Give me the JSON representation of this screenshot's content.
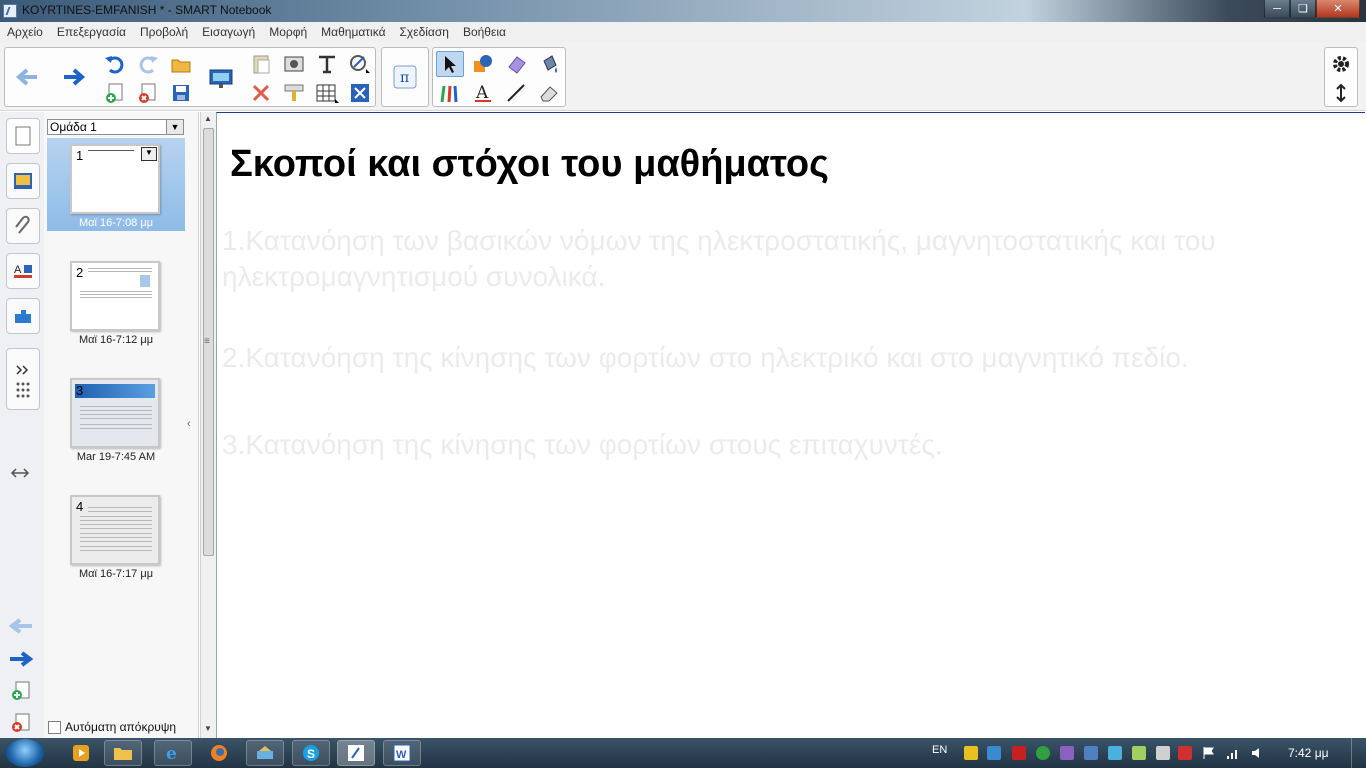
{
  "window": {
    "title": "KOYRTINES-EMFANISH * - SMART Notebook",
    "controls": [
      "minimize",
      "maximize",
      "close"
    ]
  },
  "menu": [
    "Αρχείο",
    "Επεξεργασία",
    "Προβολή",
    "Εισαγωγή",
    "Μορφή",
    "Μαθηματικά",
    "Σχεδίαση",
    "Βοήθεια"
  ],
  "toolbar": {
    "icons": [
      "back-arrow-icon",
      "forward-arrow-icon",
      "undo-icon",
      "redo-icon",
      "open-folder-icon",
      "new-page-icon",
      "delete-page-icon",
      "save-icon",
      "display-screen-icon",
      "paste-icon",
      "screen-capture-icon",
      "text-tool-icon",
      "handwriting-icon",
      "delete-icon",
      "screen-shade-icon",
      "table-icon",
      "dual-display-icon",
      "math-pi-icon",
      "select-arrow-icon",
      "shapes-icon",
      "eraser-icon",
      "fill-icon",
      "pens-icon",
      "text-a-icon",
      "line-icon",
      "magic-eraser-icon",
      "settings-gear-icon",
      "toolbar-move-icon"
    ]
  },
  "sorter": {
    "group_name": "Ομάδα 1",
    "pages": [
      {
        "number": "1",
        "date": "Μαϊ 16-7:08 μμ",
        "selected": true
      },
      {
        "number": "2",
        "date": "Μαϊ 16-7:12 μμ",
        "selected": false
      },
      {
        "number": "3",
        "date": "Mar 19-7:45 AM",
        "selected": false
      },
      {
        "number": "4",
        "date": "Μαϊ 16-7:17 μμ",
        "selected": false
      }
    ],
    "autohide_label": "Αυτόματη απόκρυψη"
  },
  "slide": {
    "title": "Σκοποί και στόχοι του μαθήματος",
    "items": [
      "1.Κατανόηση των βασικών νόμων της ηλεκτροστατικής, μαγνητοστατικής και του ηλεκτρομαγνητισμού συνολικά.",
      "2.Κατανόηση της κίνησης των φορτίων στο ηλεκτρικό και στο μαγνητικό πεδίο.",
      "3.Κατανόηση της κίνησης των φορτίων στους επιταχυντές."
    ]
  },
  "taskbar": {
    "language": "EN",
    "clock": "7:42 μμ",
    "apps": [
      "media-player-icon",
      "explorer-icon",
      "internet-explorer-icon",
      "firefox-icon",
      "network-icon",
      "skype-icon",
      "smart-notebook-icon",
      "word-icon"
    ]
  },
  "colors": {
    "selection": "#8ebbe7",
    "accent_blue": "#1d63c8",
    "canvas_border": "#1d3f88"
  }
}
